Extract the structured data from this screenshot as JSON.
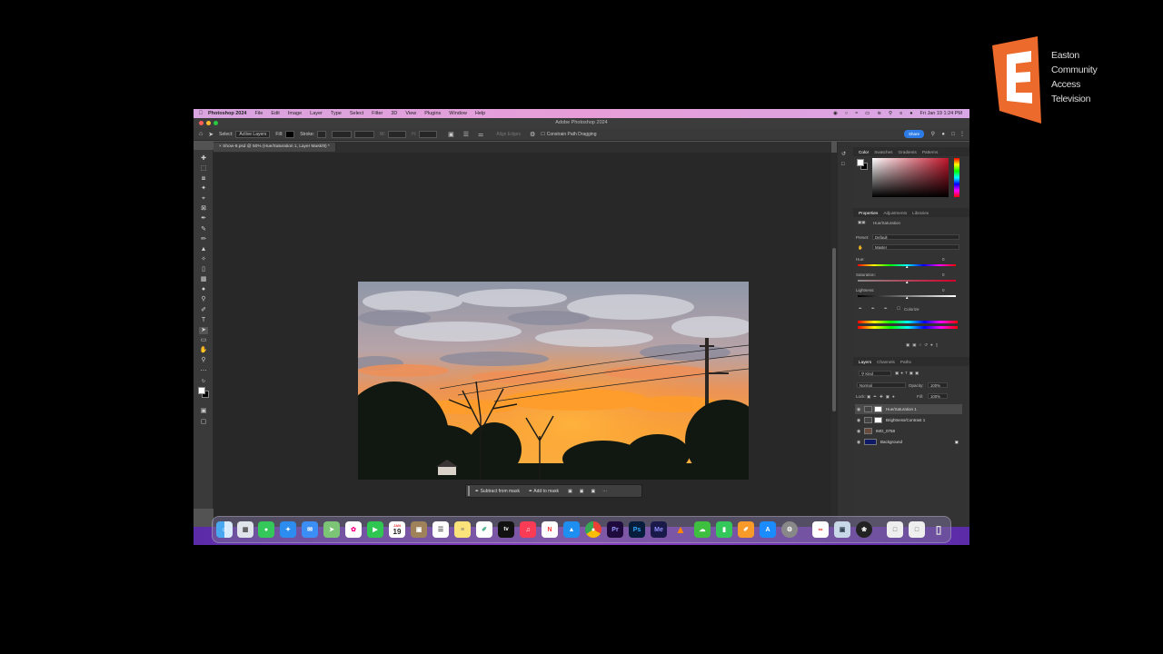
{
  "logo": {
    "lines": [
      "Easton",
      "Community",
      "Access",
      "Television"
    ],
    "brand_color": "#ec6a2c"
  },
  "menubar": {
    "apple_icon": "apple-icon",
    "items": [
      "Photoshop 2024",
      "File",
      "Edit",
      "Image",
      "Layer",
      "Type",
      "Select",
      "Filter",
      "3D",
      "View",
      "Plugins",
      "Window",
      "Help"
    ],
    "clock": "Fri Jan 19  1:24 PM"
  },
  "window": {
    "title": "Adobe Photoshop 2024"
  },
  "options_bar": {
    "select_label": "Select:",
    "select_value": "Active Layers",
    "fill_label": "Fill:",
    "stroke_label": "Stroke:",
    "align_edges": "Align Edges",
    "constrain": "Constrain Path Dragging",
    "share": "Share"
  },
  "document_tab": "Show-8.psd @ 50% (Hue/Saturation 1, Layer Mask/8) *",
  "contextual_taskbar": {
    "subtract": "Subtract from mask",
    "add": "Add to mask",
    "more": "···"
  },
  "color_panel": {
    "tabs": [
      "Color",
      "Swatches",
      "Gradients",
      "Patterns"
    ],
    "active": "Color",
    "picker_color": "#c0152a"
  },
  "properties_panel": {
    "tabs": [
      "Properties",
      "Adjustments",
      "Libraries"
    ],
    "active": "Properties",
    "adjustment": "Hue/Saturation",
    "preset_label": "Preset:",
    "preset_value": "Default",
    "channel_value": "Master",
    "hue_label": "Hue:",
    "hue_value": "0",
    "saturation_label": "Saturation:",
    "saturation_value": "0",
    "lightness_label": "Lightness:",
    "lightness_value": "0",
    "colorize_label": "Colorize"
  },
  "layers_panel": {
    "tabs": [
      "Layers",
      "Channels",
      "Paths"
    ],
    "active": "Layers",
    "kind": "Kind",
    "blend_mode": "Normal",
    "opacity_label": "Opacity:",
    "opacity_value": "100%",
    "lock_label": "Lock:",
    "fill_label": "Fill:",
    "fill_value": "100%",
    "layers": [
      {
        "name": "Hue/Saturation 1",
        "selected": true
      },
      {
        "name": "Brightness/Contrast 1",
        "selected": false
      },
      {
        "name": "IMG_0758",
        "selected": false
      },
      {
        "name": "Background",
        "selected": false
      }
    ]
  },
  "dock": {
    "apps": [
      "finder",
      "launchpad",
      "messages",
      "safari",
      "mail",
      "maps",
      "photos",
      "facetime",
      "calendar",
      "folder",
      "reminders",
      "notes",
      "freeform",
      "apple-tv",
      "music",
      "news",
      "keynote",
      "chrome",
      "premiere-pro",
      "photoshop",
      "media-encoder",
      "vlc",
      "cloud",
      "numbers",
      "pages",
      "app-store",
      "system-settings",
      "creative-cloud",
      "preview",
      "chatgpt",
      "stack",
      "stack",
      "trash"
    ],
    "calendar_day": "19",
    "calendar_month": "JAN",
    "app_labels": {
      "premiere": "Pr",
      "photoshop": "Ps",
      "media_encoder": "Me",
      "tv": "tv"
    }
  }
}
